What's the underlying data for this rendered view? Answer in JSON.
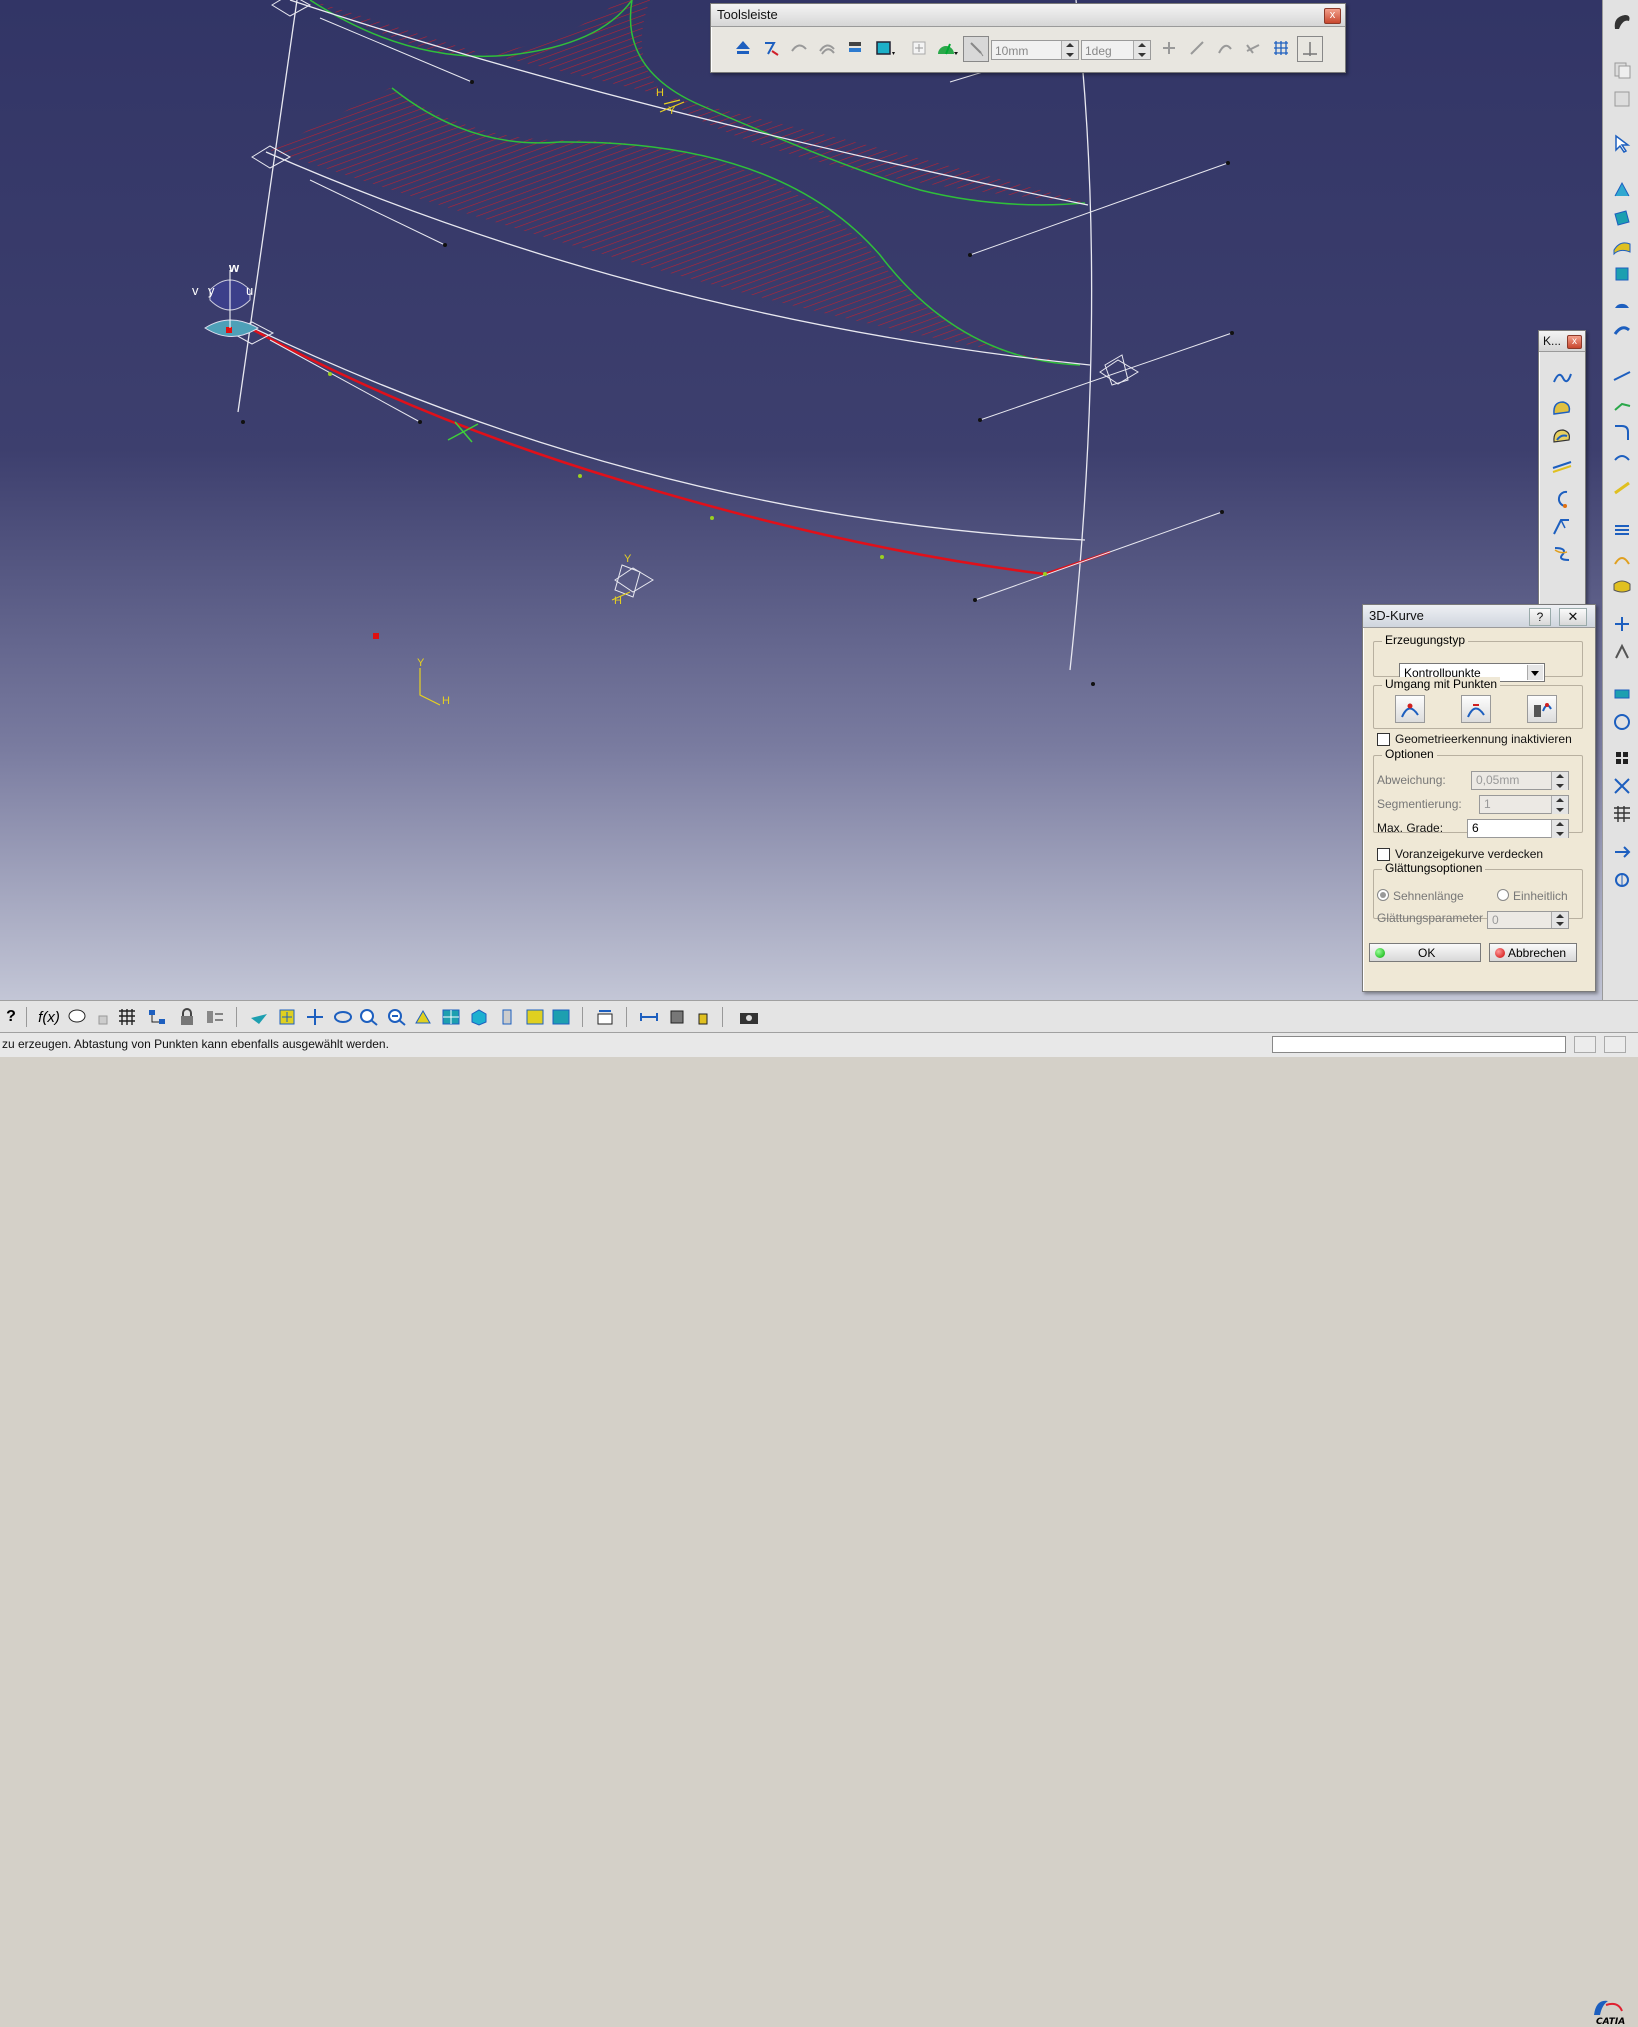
{
  "app": {
    "logo_text": "CATIA",
    "colors": {
      "viewport_top": "#323566",
      "viewport_bottom": "#c3c6d6",
      "curve_white": "#e8e8f0",
      "curve_green": "#2fbf3a",
      "hatch_red": "#c8202c",
      "curve_red": "#e0101a",
      "axis_yellow": "#e6d020"
    }
  },
  "viewport": {
    "axis_labels": {
      "w": "w",
      "v": "v",
      "y": "y",
      "u": "u",
      "h1": "H",
      "y1": "Y",
      "h2": "H",
      "y2": "Y",
      "h3": "H",
      "y3": "Y"
    }
  },
  "toolbar_float": {
    "title": "Toolsleiste",
    "close": "x",
    "distance_value": "10mm",
    "angle_value": "1deg",
    "icons": [
      "align-icon",
      "snap-point-icon",
      "surface-icon",
      "surface-copy-icon",
      "layer-icon",
      "display-icon",
      "plus-icon",
      "analysis-icon",
      "cursor-tool-icon",
      "fit-icon",
      "diagnosis-icon",
      "point-icon",
      "curvature-icon",
      "grid-icon",
      "axis-icon"
    ]
  },
  "k_toolbar": {
    "title": "K...",
    "close": "x",
    "icons": [
      "spline-icon",
      "curve-on-surface-icon",
      "iso-curve-icon",
      "projection-curve-icon",
      "circle-arc-icon",
      "match-curve-icon",
      "helix-icon"
    ]
  },
  "dialog": {
    "title": "3D-Kurve",
    "help": "?",
    "close": "✕",
    "creation_type_group": "Erzeugungstyp",
    "creation_type_value": "Kontrollpunkte",
    "points_group": "Umgang mit Punkten",
    "points_buttons": [
      "insert-point-icon",
      "remove-point-icon",
      "free-point-icon"
    ],
    "disable_geometry_detection": "Geometrieerkennung inaktivieren",
    "options_group": "Optionen",
    "deviation_label": "Abweichung:",
    "deviation_value": "0,05mm",
    "segmentation_label": "Segmentierung:",
    "segmentation_value": "1",
    "max_degree_label": "Max. Grade:",
    "max_degree_value": "6",
    "hide_preview": "Voranzeigekurve verdecken",
    "smoothing_group": "Glättungsoptionen",
    "chord_length": "Sehnenlänge",
    "uniform": "Einheitlich",
    "smoothing_param_label": "Glättungsparameter",
    "smoothing_param_value": "0",
    "ok": "OK",
    "cancel": "Abbrechen"
  },
  "status": {
    "text": "zu erzeugen. Abtastung von Punkten kann ebenfalls ausgewählt werden."
  },
  "bottom_toolbar": {
    "icons": [
      "help-icon",
      "formula-icon",
      "comment-icon",
      "lock-icon",
      "table-icon",
      "tree-icon",
      "padlock-icon",
      "selector-icon",
      "fly-icon",
      "fit-all-icon",
      "pan-icon",
      "rotate-icon",
      "zoom-in-icon",
      "zoom-out-icon",
      "normal-view-icon",
      "multi-view-icon",
      "iso-view-icon",
      "render-style-icon",
      "shading-icon",
      "hide-show-icon",
      "swap-icon",
      "measure-icon",
      "inertia-icon",
      "weight-icon",
      "camera-icon"
    ]
  },
  "right_toolbar": {
    "icons": [
      "catia-start-icon",
      "copy-icon",
      "paste-icon",
      "select-icon",
      "sketch-icon",
      "plane-icon",
      "surface-icon",
      "extrude-icon",
      "revolve-icon",
      "sweep-icon",
      "line-icon",
      "corner-icon",
      "fillet-icon",
      "split-icon",
      "connect-icon",
      "multi-section-icon",
      "blend-icon",
      "join-icon",
      "offset-icon",
      "helix-icon",
      "measure-icon",
      "constraint-icon",
      "check-icon",
      "analysis-icon",
      "table-icon",
      "pointer-icon",
      "tool-icon"
    ]
  }
}
